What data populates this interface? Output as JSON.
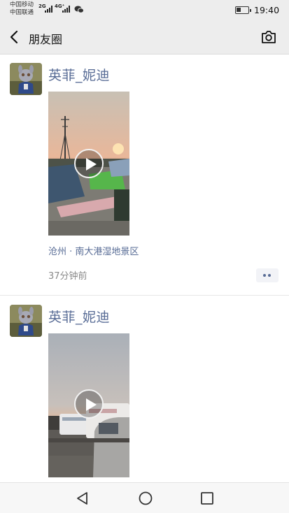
{
  "status_bar": {
    "carrier_1": "中国移动",
    "carrier_2": "中国联通",
    "signal_1_label": "2G",
    "signal_2_label": "4G⁺",
    "time": "19:40",
    "icons": [
      "wechat-icon",
      "battery-icon"
    ]
  },
  "nav": {
    "title": "朋友圈",
    "icons": [
      "back-arrow-icon",
      "camera-icon"
    ]
  },
  "posts": [
    {
      "name": "英菲_妮迪",
      "media_type": "video",
      "location": "沧州 · 南大港湿地景区",
      "time": "37分钟前"
    },
    {
      "name": "英菲_妮迪",
      "media_type": "video"
    }
  ],
  "android_nav": {
    "icons": [
      "back-triangle-icon",
      "home-circle-icon",
      "recent-square-icon"
    ]
  },
  "colors": {
    "link": "#576b95",
    "bar_bg": "#ededed",
    "meta_gray": "#8a8a8a"
  }
}
